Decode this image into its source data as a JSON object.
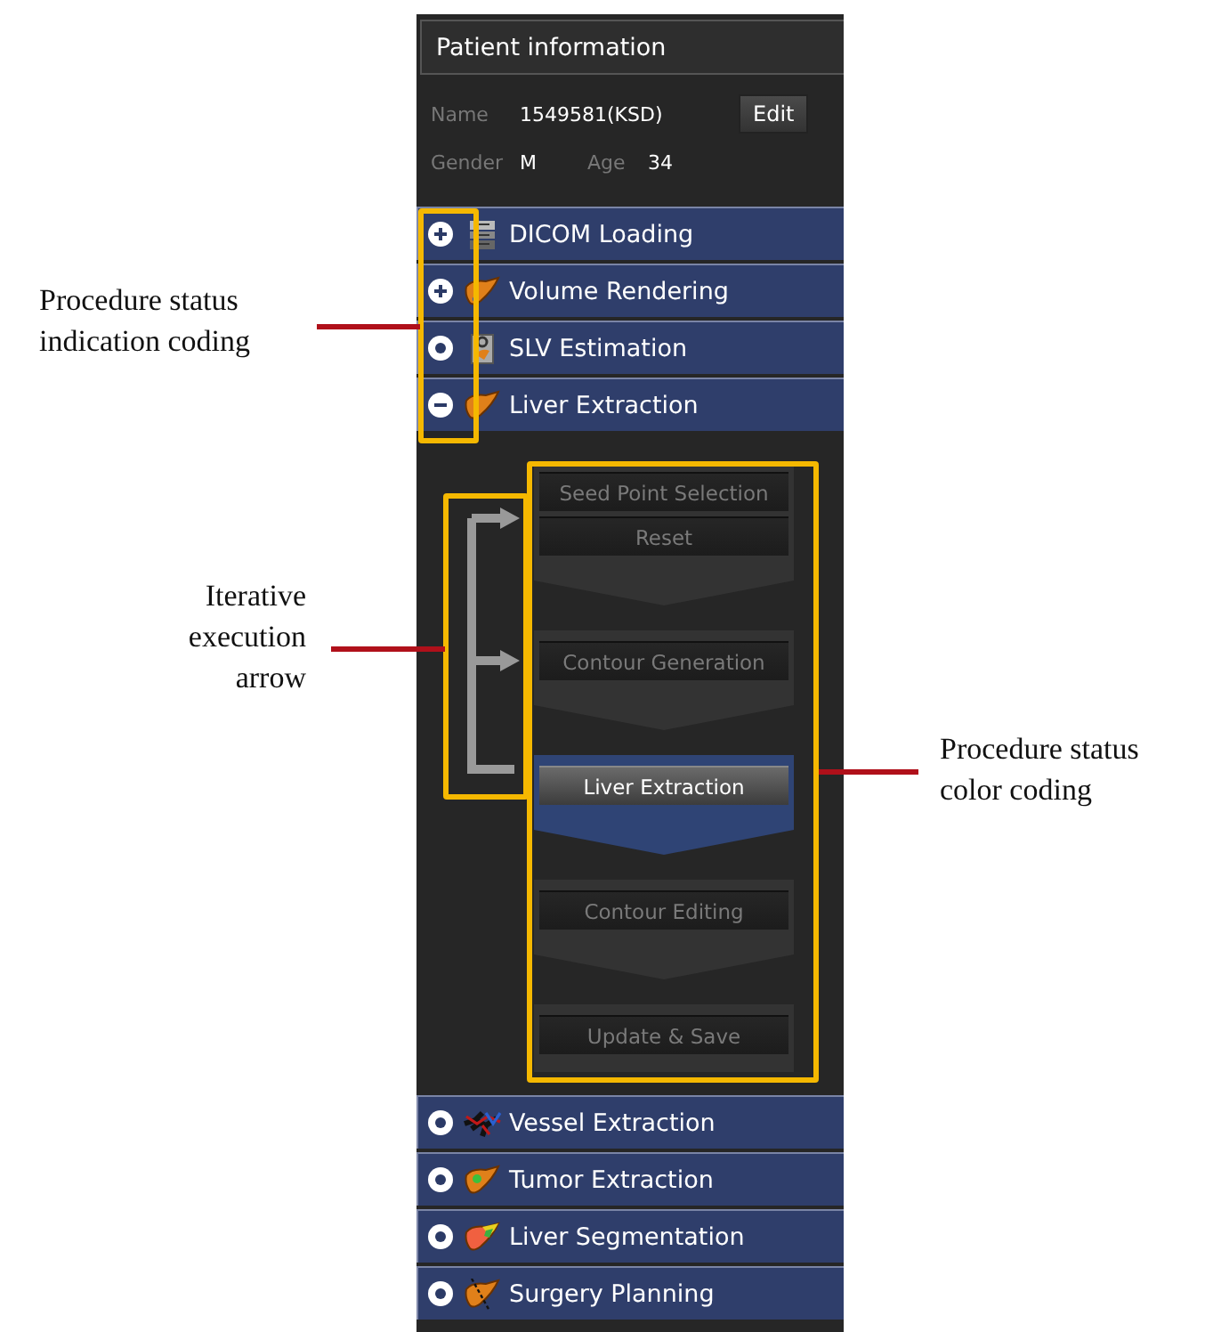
{
  "patient_panel": {
    "title": "Patient information",
    "name_label": "Name",
    "name_value": "1549581(KSD)",
    "edit_button": "Edit",
    "gender_label": "Gender",
    "gender_value": "M",
    "age_label": "Age",
    "age_value": "34"
  },
  "procedures_top": [
    {
      "label": "DICOM Loading",
      "completed": true,
      "expanded": false
    },
    {
      "label": "Volume Rendering",
      "completed": true,
      "expanded": false
    },
    {
      "label": "SLV Estimation",
      "completed": false,
      "expanded": false
    },
    {
      "label": "Liver Extraction",
      "expanded": true
    }
  ],
  "steps": [
    {
      "selected": false,
      "buttons": [
        "Seed Point Selection",
        "Reset"
      ]
    },
    {
      "selected": false,
      "buttons": [
        "Contour Generation"
      ]
    },
    {
      "selected": true,
      "buttons": [
        "Liver Extraction"
      ]
    },
    {
      "selected": false,
      "buttons": [
        "Contour Editing"
      ]
    },
    {
      "selected": false,
      "buttons": [
        "Update & Save"
      ]
    }
  ],
  "procedures_bottom": [
    {
      "label": "Vessel Extraction",
      "completed": false,
      "expanded": false
    },
    {
      "label": "Tumor Extraction",
      "completed": false,
      "expanded": false
    },
    {
      "label": "Liver Segmentation",
      "completed": false,
      "expanded": false
    },
    {
      "label": "Surgery Planning",
      "completed": false,
      "expanded": false
    }
  ],
  "annotations": [
    {
      "kind": "status_indication",
      "text": "Procedure status indication coding"
    },
    {
      "kind": "iteration_arrow",
      "text": "Iterative execution arrow"
    },
    {
      "kind": "status_color",
      "text": "Procedure status color coding"
    }
  ]
}
